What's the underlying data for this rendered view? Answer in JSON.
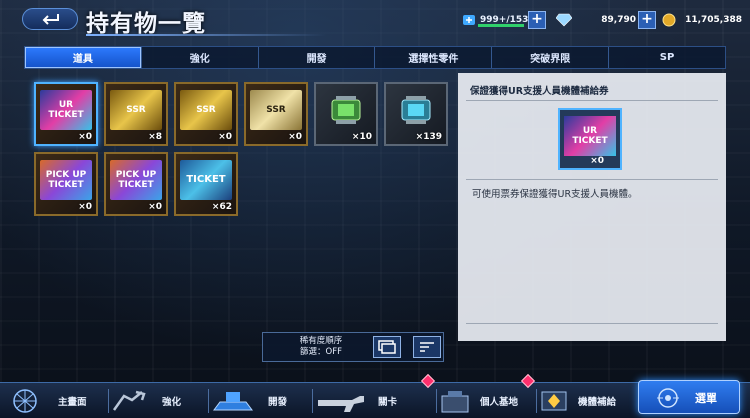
{
  "header": {
    "title": "持有物一覽",
    "resources": {
      "stamina": "999+/153",
      "crystals": "89,790",
      "coins": "11,705,388"
    }
  },
  "tabs": [
    "道具",
    "強化",
    "開發",
    "選擇性零件",
    "突破界限",
    "SP"
  ],
  "active_tab": "道具",
  "items": [
    {
      "art": "UR TICKET",
      "count": "×0",
      "type": "ur"
    },
    {
      "art": "SSR",
      "count": "×8",
      "type": "gold"
    },
    {
      "art": "SSR",
      "count": "×0",
      "type": "gold"
    },
    {
      "art": "SSR",
      "count": "×0",
      "type": "silver"
    },
    {
      "art": "",
      "count": "×10",
      "type": "canister-green"
    },
    {
      "art": "",
      "count": "×139",
      "type": "canister-cyan"
    },
    {
      "art": "PICK UP TICKET",
      "count": "×0",
      "type": "pickup"
    },
    {
      "art": "PICK UP TICKET",
      "count": "×0",
      "type": "pickup"
    },
    {
      "art": "TICKET",
      "count": "×62",
      "type": "ticket"
    }
  ],
  "detail": {
    "title": "保證獲得UR支援人員機體補給券",
    "art": "UR TICKET",
    "count": "×0",
    "description": "可使用票券保證獲得UR支援人員機體。"
  },
  "sort": {
    "line1": "稀有度順序",
    "line2": "篩選：OFF"
  },
  "nav": {
    "home": "主畫面",
    "enhance": "強化",
    "develop": "開發",
    "stage": "關卡",
    "base": "個人基地",
    "supply": "機體補給",
    "menu": "選單"
  },
  "colors": {
    "accent": "#2d7bff",
    "badge": "#ff2f6d",
    "gold": "#d8b23a"
  }
}
